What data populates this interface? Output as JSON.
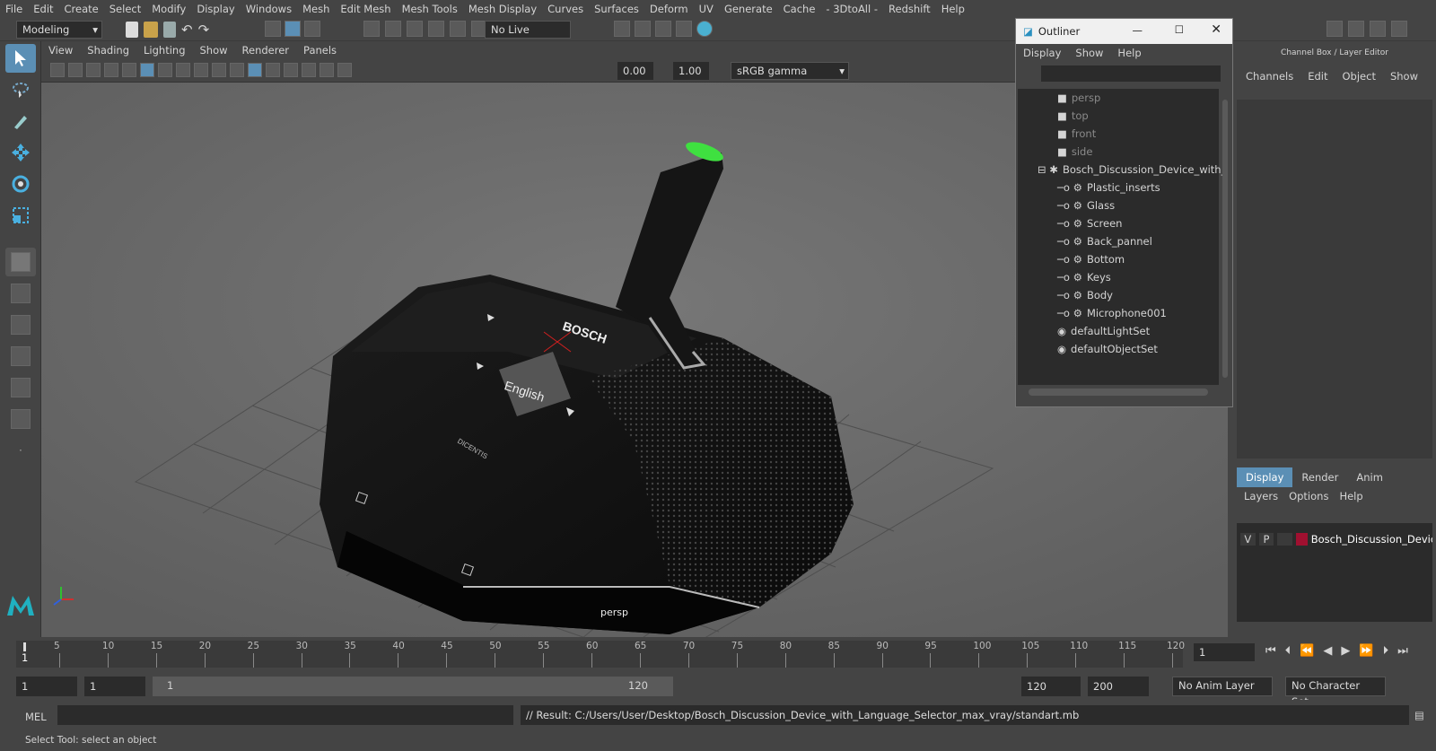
{
  "menubar": {
    "items": [
      "File",
      "Edit",
      "Create",
      "Select",
      "Modify",
      "Display",
      "Windows",
      "Mesh",
      "Edit Mesh",
      "Mesh Tools",
      "Mesh Display",
      "Curves",
      "Surfaces",
      "Deform",
      "UV",
      "Generate",
      "Cache",
      "- 3DtoAll -",
      "Redshift",
      "Help"
    ]
  },
  "toolbar": {
    "mode": "Modeling",
    "live_surface": "No Live Surface"
  },
  "panel": {
    "menu": [
      "View",
      "Shading",
      "Lighting",
      "Show",
      "Renderer",
      "Panels"
    ],
    "exposure": "0.00",
    "gamma": "1.00",
    "color_space": "sRGB gamma",
    "camera_label": "persp"
  },
  "model": {
    "brand": "BOSCH",
    "screen_text": "English",
    "sub_brand": "DICENTIS"
  },
  "outliner": {
    "title": "Outliner",
    "menu": [
      "Display",
      "Show",
      "Help"
    ],
    "cameras": [
      "persp",
      "top",
      "front",
      "side"
    ],
    "group": "Bosch_Discussion_Device_with_",
    "children": [
      "Plastic_inserts",
      "Glass",
      "Screen",
      "Back_pannel",
      "Bottom",
      "Keys",
      "Body",
      "Microphone001"
    ],
    "sets": [
      "defaultLightSet",
      "defaultObjectSet"
    ]
  },
  "channelbox": {
    "title": "Channel Box / Layer Editor",
    "menu": [
      "Channels",
      "Edit",
      "Object",
      "Show"
    ],
    "tabs": [
      "Display",
      "Render",
      "Anim"
    ],
    "layer_menu": [
      "Layers",
      "Options",
      "Help"
    ],
    "layer": {
      "v": "V",
      "p": "P",
      "name": "Bosch_Discussion_Device",
      "color": "#a01030"
    }
  },
  "timeline": {
    "ticks": [
      "5",
      "10",
      "15",
      "20",
      "25",
      "30",
      "35",
      "40",
      "45",
      "50",
      "55",
      "60",
      "65",
      "70",
      "75",
      "80",
      "85",
      "90",
      "95",
      "100",
      "105",
      "110",
      "115",
      "120"
    ],
    "current_start": "1",
    "current_frame": "1"
  },
  "range": {
    "start": "1",
    "start2": "1",
    "slider_start": "1",
    "slider_end": "120",
    "end": "120",
    "end2": "200",
    "anim_layer": "No Anim Layer",
    "char_set": "No Character Set"
  },
  "cmd": {
    "label": "MEL",
    "result": "// Result: C:/Users/User/Desktop/Bosch_Discussion_Device_with_Language_Selector_max_vray/standart.mb"
  },
  "help": {
    "text": "Select Tool: select an object"
  }
}
